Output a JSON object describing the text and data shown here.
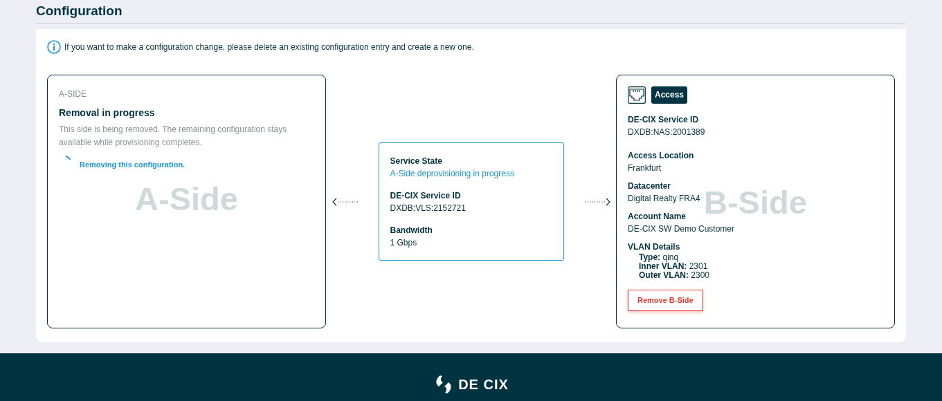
{
  "page_title": "Configuration",
  "info": "If you want to make a configuration change, please delete an existing configuration entry and create a new one.",
  "a_side": {
    "label": "A-SIDE",
    "title": "Removal in progress",
    "description": "This side is being removed. The remaining configuration stays available while provisioning completes.",
    "status": "Removing this configuration.",
    "watermark": "A-Side"
  },
  "connection": {
    "fields": [
      {
        "label": "Service State",
        "value": "A-Side deprovisioning in progress",
        "kind": "status"
      },
      {
        "label": "DE-CIX Service ID",
        "value": "DXDB:VLS:2152721",
        "kind": "plain"
      },
      {
        "label": "Bandwidth",
        "value": "1 Gbps",
        "kind": "plain"
      }
    ]
  },
  "b_side": {
    "badge": "Access",
    "watermark": "B-Side",
    "fields": [
      {
        "label": "DE-CIX Service ID",
        "value": "DXDB:NAS:2001389"
      },
      {
        "label": "Access Location",
        "value": "Frankfurt"
      },
      {
        "label": "Datacenter",
        "value": "Digital Realty FRA4"
      },
      {
        "label": "Account Name",
        "value": "DE-CIX SW Demo Customer"
      }
    ],
    "vlan": {
      "label": "VLAN Details",
      "items": [
        {
          "label": "Type:",
          "value": "qinq"
        },
        {
          "label": "Inner VLAN:",
          "value": "2301"
        },
        {
          "label": "Outer VLAN:",
          "value": "2300"
        }
      ]
    },
    "remove_button": "Remove B-Side"
  },
  "footer": {
    "logo_text": "DE CIX"
  }
}
